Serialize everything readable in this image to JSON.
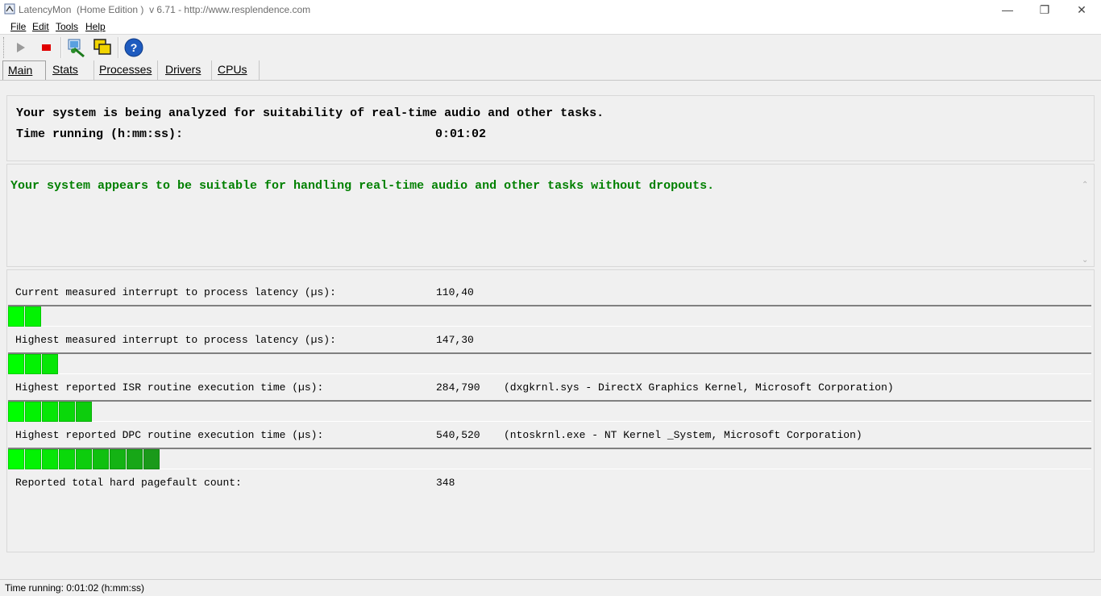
{
  "window": {
    "title": "LatencyMon  (Home Edition )  v 6.71 - http://www.resplendence.com",
    "minimize": "—",
    "restore": "❐",
    "close": "✕"
  },
  "menu": [
    "File",
    "Edit",
    "Tools",
    "Help"
  ],
  "toolbar": {
    "icons": [
      "play-icon",
      "stop-icon",
      "analyze-icon",
      "windows-icon",
      "help-icon"
    ],
    "help_glyph": "?"
  },
  "tabs": [
    "Main",
    "Stats",
    "Processes",
    "Drivers",
    "CPUs"
  ],
  "analysis": {
    "line1": "Your system is being analyzed for suitability of real-time audio and other tasks.",
    "time_label": "Time running (h:mm:ss):",
    "time_value": "0:01:02"
  },
  "verdict": {
    "text": "Your system appears to be suitable for handling real-time audio and other tasks without dropouts.",
    "color": "#008000"
  },
  "metrics": [
    {
      "label": "Current measured interrupt to process latency (µs):",
      "value": "110,40",
      "detail": "",
      "segments": 2
    },
    {
      "label": "Highest measured interrupt to process latency (µs):",
      "value": "147,30",
      "detail": "",
      "segments": 3
    },
    {
      "label": "Highest reported ISR routine execution time (µs):",
      "value": "284,790",
      "detail": "(dxgkrnl.sys - DirectX Graphics Kernel, Microsoft Corporation)",
      "segments": 5
    },
    {
      "label": "Highest reported DPC routine execution time (µs):",
      "value": "540,520",
      "detail": "(ntoskrnl.exe - NT Kernel _System, Microsoft Corporation)",
      "segments": 9
    }
  ],
  "pagefault": {
    "label": "Reported total hard pagefault count:",
    "value": "348"
  },
  "status": "Time running: 0:01:02  (h:mm:ss)",
  "colors": {
    "bar_light": "#00ff00",
    "bar_dark": "#1a9a1a"
  }
}
